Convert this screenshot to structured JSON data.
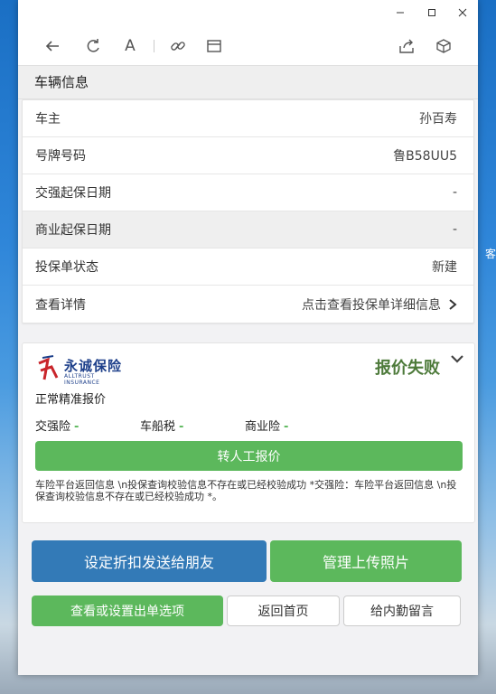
{
  "desktop": {
    "edge_text": "客"
  },
  "window": {
    "controls": {
      "minimize": "−",
      "maximize": "☐",
      "close": "✕"
    }
  },
  "toolbar": {
    "icons": [
      "back-arrow-icon",
      "refresh-icon",
      "font-icon",
      "link-icon",
      "window-icon",
      "share-icon",
      "cube-icon"
    ]
  },
  "vehicle_section": {
    "title": "车辆信息",
    "rows": [
      {
        "label": "车主",
        "value": "孙百寿"
      },
      {
        "label": "号牌号码",
        "value": "鲁B58UU5"
      },
      {
        "label": "交强起保日期",
        "value": "-"
      },
      {
        "label": "商业起保日期",
        "value": "-"
      },
      {
        "label": "投保单状态",
        "value": "新建"
      },
      {
        "label": "查看详情",
        "value": "点击查看投保单详细信息"
      }
    ]
  },
  "quote": {
    "company_logo": "永诚保险",
    "company_logo_en": "ALLTRUST INSURANCE",
    "status": "报价失败",
    "mode": "正常精准报价",
    "premiums": [
      {
        "label": "交强险",
        "value": "-"
      },
      {
        "label": "车船税",
        "value": "-"
      },
      {
        "label": "商业险",
        "value": "-"
      }
    ],
    "manual_button": "转人工报价",
    "note": "车险平台返回信息 \\n投保查询校验信息不存在或已经校验成功 *交强险：车险平台返回信息 \\n投保查询校验信息不存在或已经校验成功 *。"
  },
  "actions": {
    "share_discount": "设定折扣发送给朋友",
    "manage_photos": "管理上传照片",
    "order_options": "查看或设置出单选项",
    "home": "返回首页",
    "message_staff": "给内勤留言"
  },
  "colors": {
    "green": "#5cb85c",
    "blue": "#337ab7",
    "status_fail": "#4d7a3a"
  }
}
